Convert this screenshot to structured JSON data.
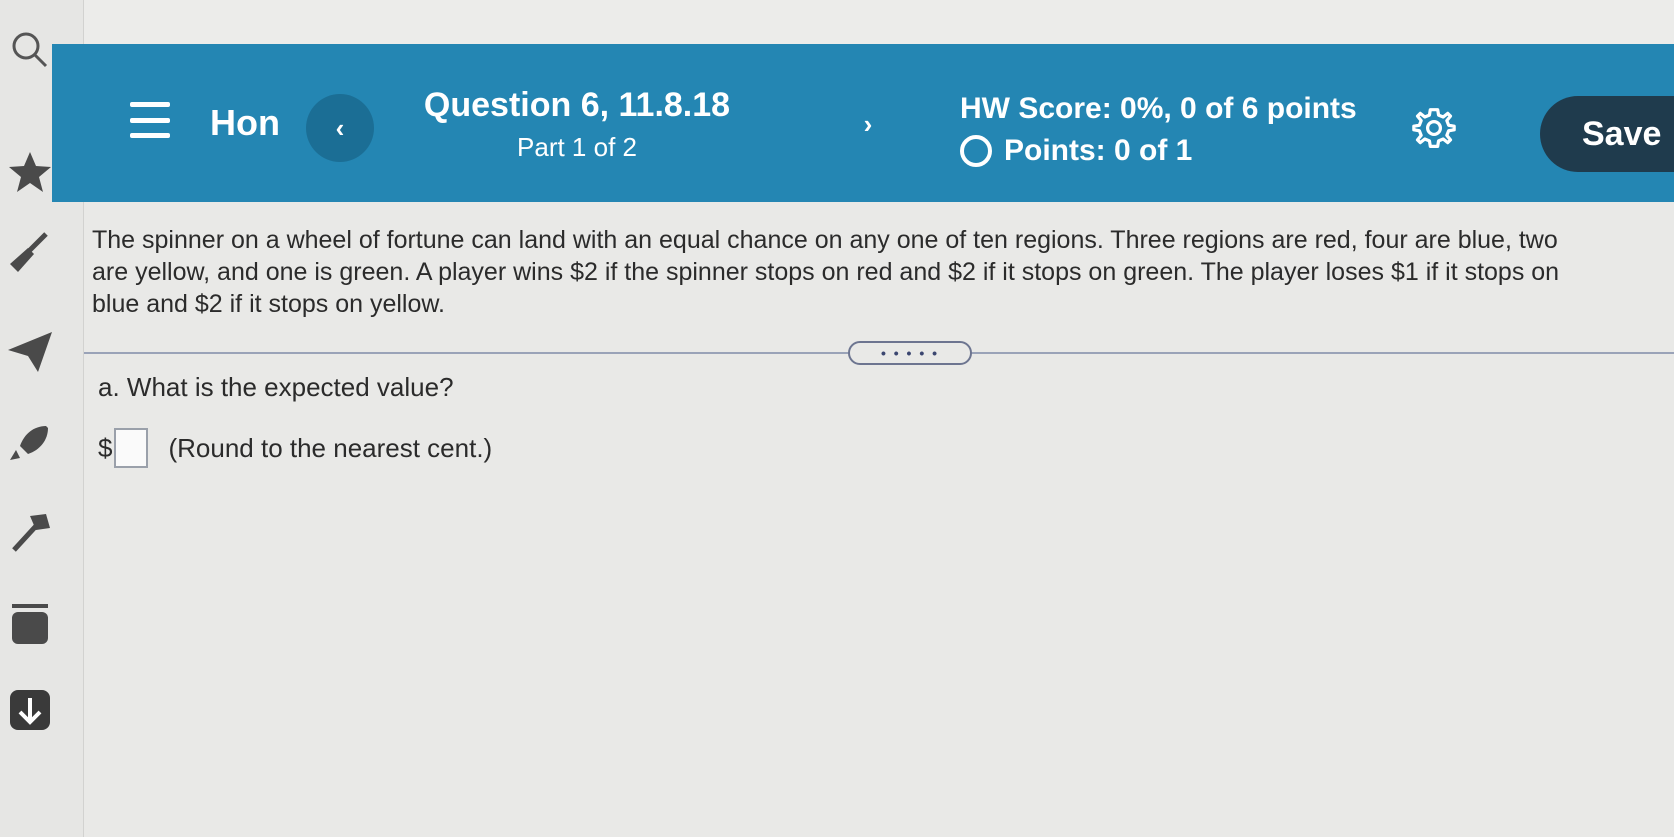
{
  "header": {
    "menu_icon": "hamburger-icon",
    "home_label": "Hon",
    "prev_icon": "chevron-left-icon",
    "question_title": "Question 6, 11.8.18",
    "question_part": "Part 1 of 2",
    "next_icon": "chevron-right-icon",
    "hw_score": "HW Score: 0%, 0 of 6 points",
    "points": "Points: 0 of 1",
    "settings_icon": "gear-icon",
    "save_label": "Save"
  },
  "dock": {
    "icons": [
      "search-icon",
      "star-icon",
      "broom-icon",
      "paper-plane-icon",
      "rocket-icon",
      "hammer-icon",
      "archive-icon",
      "download-icon"
    ]
  },
  "problem": {
    "text": "The spinner on a wheel of fortune can land with an equal chance on any one of ten regions.  Three regions are red, four are blue, two\nare yellow, and one is green.  A player wins $2 if the spinner stops on red and $2 if it stops on green.  The player loses $1 if it stops on\nblue and $2 if it stops on yellow."
  },
  "expand_label": "• • • • •",
  "part_a": {
    "prompt": "a. What is the expected value?",
    "currency": "$",
    "answer_value": "",
    "note": "(Round to the nearest cent.)"
  },
  "colors": {
    "banner": "#2486b3",
    "save_button": "#1f3b4d",
    "prev_button": "#1b6e95"
  }
}
